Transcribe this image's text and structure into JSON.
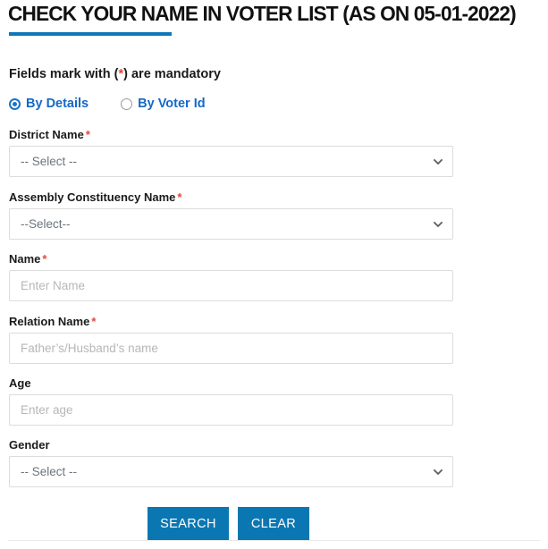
{
  "header": {
    "title": "CHECK YOUR NAME IN VOTER LIST (AS ON 05-01-2022)",
    "accent_color": "#0d78b8"
  },
  "notice": {
    "prefix": "Fields mark with (",
    "star": "*",
    "suffix": ") are mandatory"
  },
  "search_mode": {
    "options": [
      {
        "label": "By Details",
        "selected": true
      },
      {
        "label": "By Voter Id",
        "selected": false
      }
    ],
    "label_color": "#1569c7"
  },
  "form": {
    "required_marker": "*",
    "fields": [
      {
        "name": "district-name",
        "label": "District Name",
        "required": true,
        "type": "select",
        "value": "-- Select --",
        "icon": "chevron-down-icon"
      },
      {
        "name": "assembly-constituency-name",
        "label": "Assembly Constituency Name",
        "required": true,
        "type": "select",
        "value": "--Select--",
        "icon": "chevron-down-icon"
      },
      {
        "name": "name",
        "label": "Name",
        "required": true,
        "type": "text",
        "value": "",
        "placeholder": "Enter Name"
      },
      {
        "name": "relation-name",
        "label": "Relation Name",
        "required": true,
        "type": "text",
        "value": "",
        "placeholder": "Father’s/Husband’s name"
      },
      {
        "name": "age",
        "label": "Age",
        "required": false,
        "type": "text",
        "value": "",
        "placeholder": "Enter age"
      },
      {
        "name": "gender",
        "label": "Gender",
        "required": false,
        "type": "select",
        "value": "-- Select --",
        "icon": "chevron-down-icon"
      }
    ]
  },
  "actions": {
    "search_label": "SEARCH",
    "clear_label": "CLEAR",
    "button_color": "#0b77b2"
  }
}
